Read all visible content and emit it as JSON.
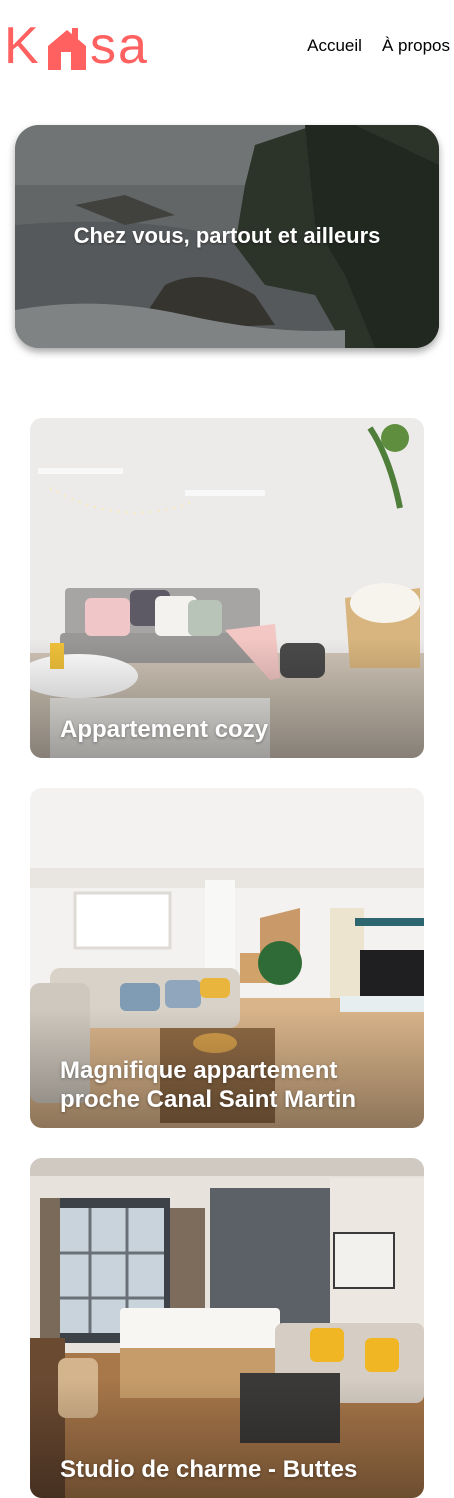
{
  "brand": {
    "name_parts": [
      "K",
      "sa"
    ],
    "color": "#FF6060"
  },
  "nav": {
    "items": [
      {
        "label": "Accueil"
      },
      {
        "label": "À propos"
      }
    ]
  },
  "hero": {
    "title": "Chez vous, partout et ailleurs"
  },
  "listings": [
    {
      "title": "Appartement cozy"
    },
    {
      "title": "Magnifique appartement proche Canal Saint Martin"
    },
    {
      "title": "Studio de charme - Buttes"
    }
  ]
}
